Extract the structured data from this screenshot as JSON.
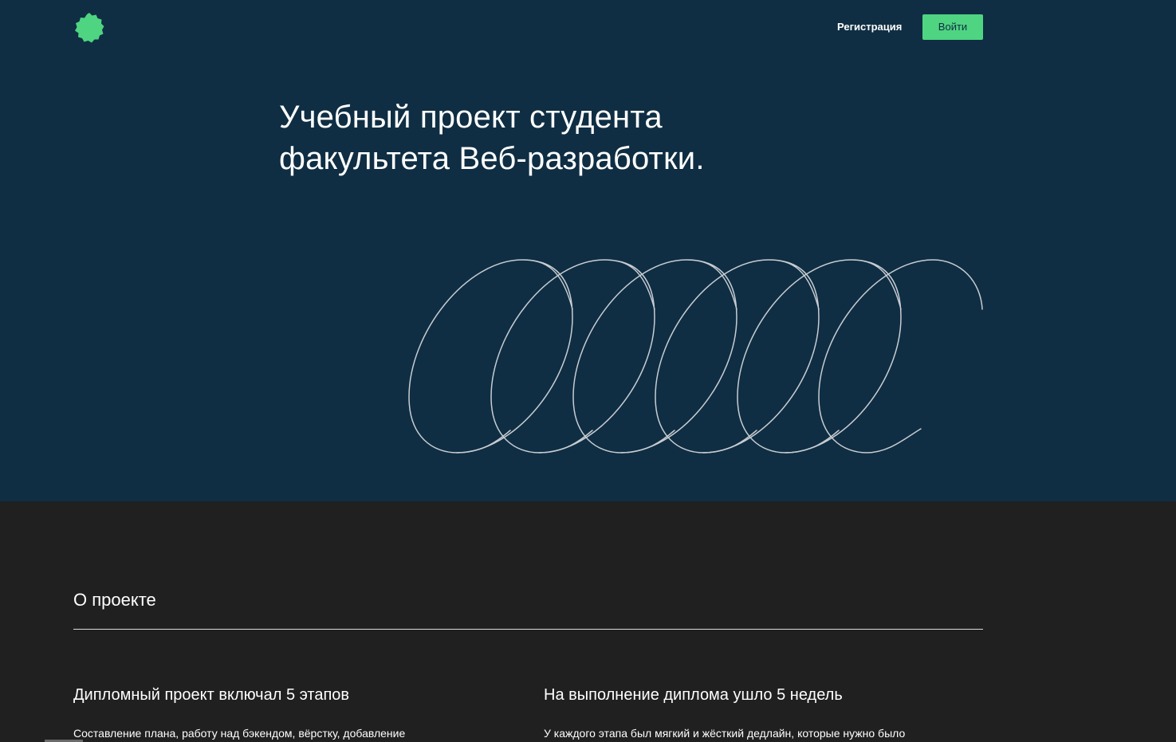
{
  "header": {
    "logo_icon": "green-badge-icon",
    "register_label": "Регистрация",
    "login_label": "Войти"
  },
  "hero": {
    "title_line1": "Учебный проект студента",
    "title_line2": "факультета Веб-разработки."
  },
  "about": {
    "title": "О проекте",
    "columns": [
      {
        "title": "Дипломный проект включал 5 этапов",
        "text": "Составление плана, работу над бэкендом, вёрстку, добавление"
      },
      {
        "title": "На выполнение диплома ушло 5 недель",
        "text": "У каждого этапа был мягкий и жёсткий дедлайн, которые нужно было"
      }
    ]
  },
  "colors": {
    "hero_bg": "#0f2e43",
    "about_bg": "#202020",
    "accent": "#4fd482"
  }
}
